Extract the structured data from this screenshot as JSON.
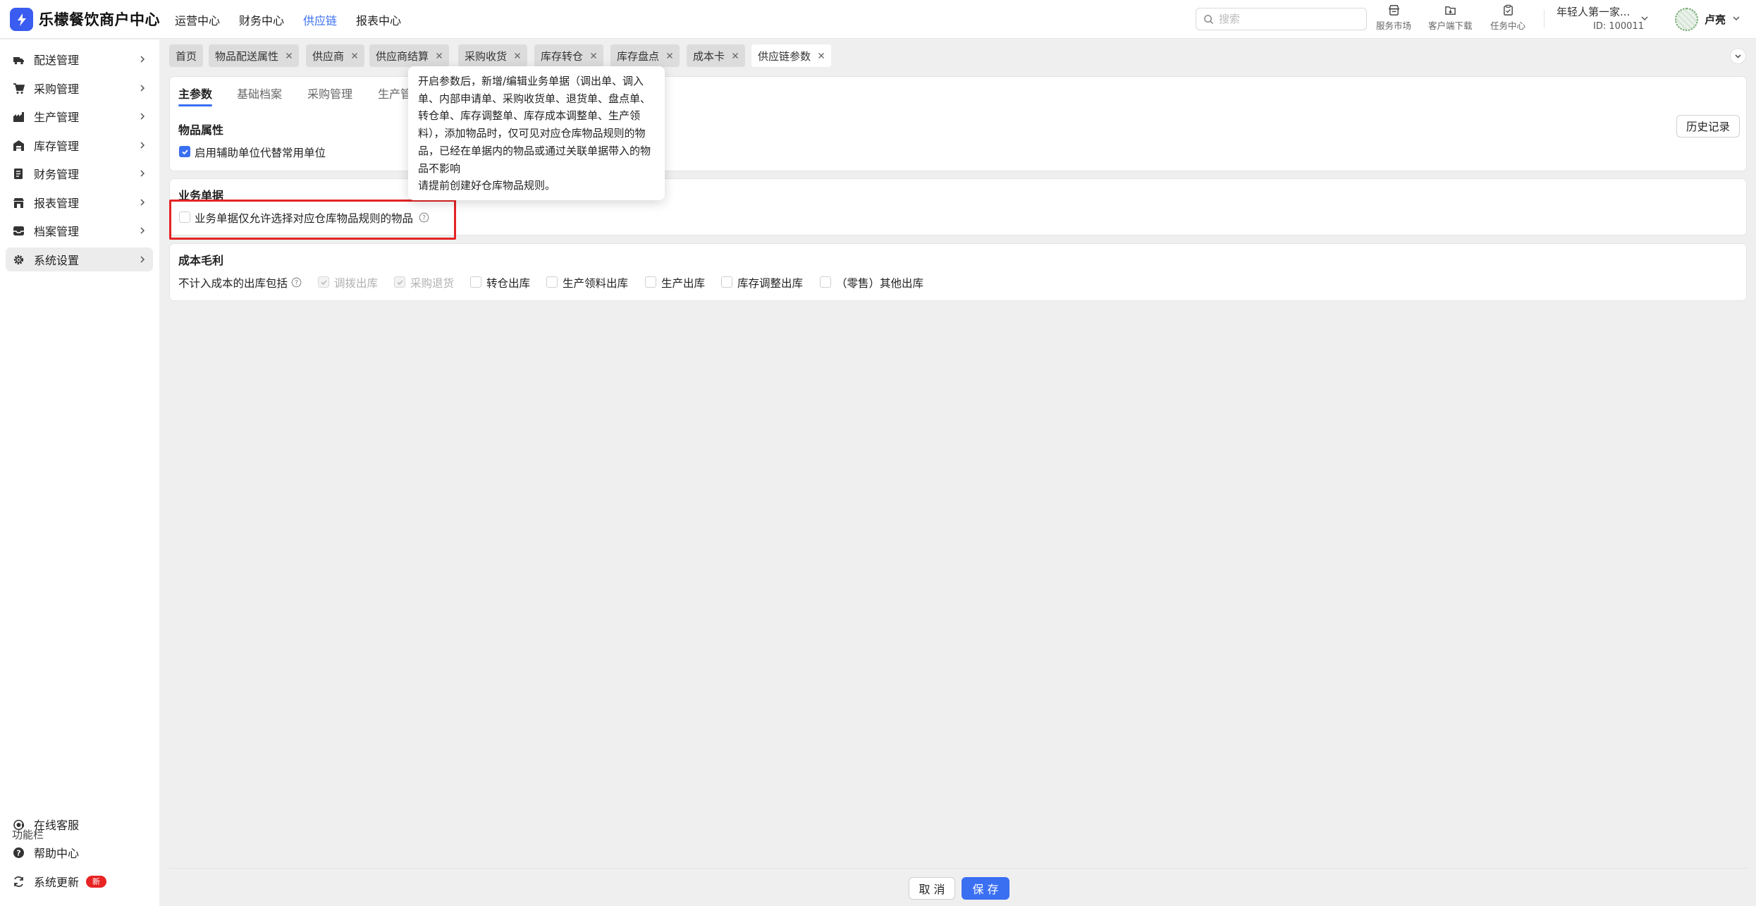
{
  "app": {
    "brand": "乐檬餐饮商户中心"
  },
  "topnav": [
    {
      "label": "运营中心",
      "active": false
    },
    {
      "label": "财务中心",
      "active": false
    },
    {
      "label": "供应链",
      "active": true
    },
    {
      "label": "报表中心",
      "active": false
    }
  ],
  "search": {
    "placeholder": "搜索"
  },
  "tools": {
    "market": "服务市场",
    "download": "客户端下载",
    "tasks": "任务中心"
  },
  "store": {
    "name": "年轻人第一家...",
    "id": "ID: 100011"
  },
  "user": {
    "name": "卢亮"
  },
  "sidebar": {
    "items": [
      {
        "label": "配送管理",
        "icon": "truck-icon"
      },
      {
        "label": "采购管理",
        "icon": "cart-icon"
      },
      {
        "label": "生产管理",
        "icon": "factory-icon"
      },
      {
        "label": "库存管理",
        "icon": "warehouse-icon"
      },
      {
        "label": "财务管理",
        "icon": "finance-icon"
      },
      {
        "label": "报表管理",
        "icon": "report-icon"
      },
      {
        "label": "档案管理",
        "icon": "archive-icon"
      },
      {
        "label": "系统设置",
        "icon": "gear-icon",
        "active": true
      }
    ],
    "function_title": "功能栏",
    "functions": [
      {
        "label": "在线客服",
        "icon": "headset-icon"
      },
      {
        "label": "帮助中心",
        "icon": "help-icon"
      },
      {
        "label": "系统更新",
        "icon": "refresh-icon",
        "badge": "新"
      }
    ]
  },
  "tabs": [
    {
      "label": "首页",
      "closable": false
    },
    {
      "label": "物品配送属性",
      "closable": true
    },
    {
      "label": "供应商",
      "closable": true
    },
    {
      "label": "供应商结算",
      "closable": true
    },
    {
      "label": "采购收货",
      "closable": true
    },
    {
      "label": "库存转仓",
      "closable": true
    },
    {
      "label": "库存盘点",
      "closable": true
    },
    {
      "label": "成本卡",
      "closable": true
    },
    {
      "label": "供应链参数",
      "closable": true,
      "active": true
    }
  ],
  "subtabs": [
    "主参数",
    "基础档案",
    "采购管理",
    "生产管"
  ],
  "history_button": "历史记录",
  "sections": {
    "item_props": {
      "title": "物品属性",
      "option": {
        "label": "启用辅助单位代替常用单位",
        "checked": true
      }
    },
    "biz_docs": {
      "title": "业务单据",
      "option": {
        "label": "业务单据仅允许选择对应仓库物品规则的物品",
        "checked": false
      }
    },
    "cost": {
      "title": "成本毛利",
      "label": "不计入成本的出库包括",
      "options": [
        {
          "label": "调拨出库",
          "checked": true,
          "disabled": true
        },
        {
          "label": "采购退货",
          "checked": true,
          "disabled": true
        },
        {
          "label": "转仓出库",
          "checked": false,
          "disabled": false
        },
        {
          "label": "生产领料出库",
          "checked": false,
          "disabled": false
        },
        {
          "label": "生产出库",
          "checked": false,
          "disabled": false
        },
        {
          "label": "库存调整出库",
          "checked": false,
          "disabled": false
        },
        {
          "label": "（零售）其他出库",
          "checked": false,
          "disabled": false
        }
      ]
    }
  },
  "tooltip": {
    "lines": [
      "开启参数后，新增/编辑业务单据（调出单、调入单、内部申请单、采购收货单、退货单、盘点单、转仓单、库存调整单、库存成本调整单、生产领料），添加物品时，仅可见对应仓库物品规则的物品，已经在单据内的物品或通过关联单据带入的物品不影响",
      "请提前创建好仓库物品规则。"
    ]
  },
  "footer": {
    "cancel": "取 消",
    "save": "保 存"
  },
  "colors": {
    "accent": "#3a6ff2",
    "highlight": "#e42424",
    "badge": "#e82323"
  }
}
